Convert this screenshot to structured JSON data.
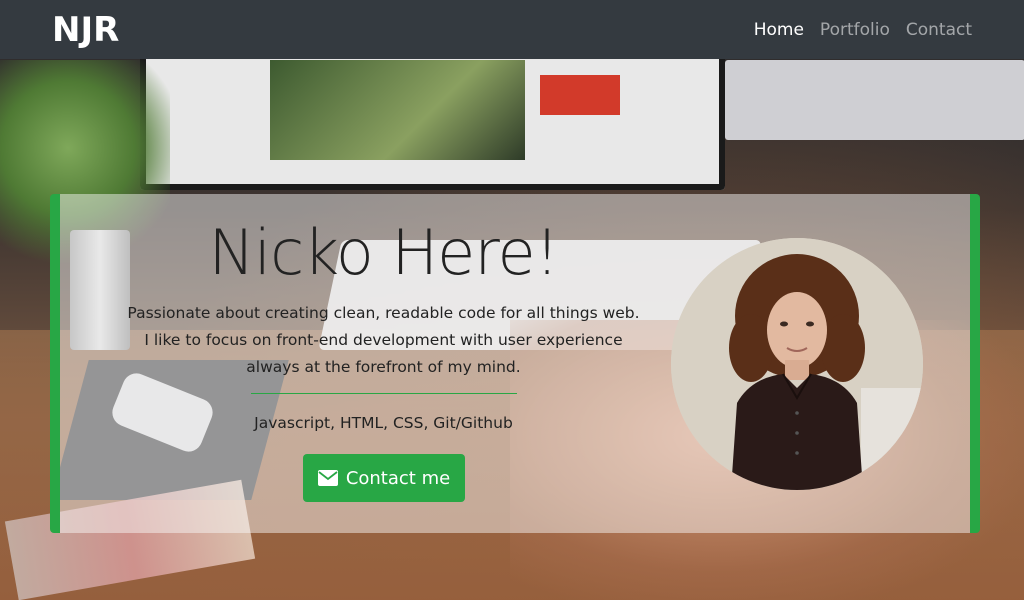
{
  "navbar": {
    "brand": "NJR",
    "links": [
      {
        "label": "Home",
        "active": true
      },
      {
        "label": "Portfolio",
        "active": false
      },
      {
        "label": "Contact",
        "active": false
      }
    ]
  },
  "hero": {
    "title": "Nicko Here!",
    "description": [
      "Passionate about creating clean, readable code for all things web.",
      "I like to focus on front-end development with user experience",
      "always at the forefront of my mind."
    ],
    "skills": "Javascript, HTML, CSS, Git/Github",
    "contact_button": {
      "label": "Contact me",
      "icon": "envelope-icon"
    }
  },
  "colors": {
    "navbar_bg": "#343a40",
    "accent_green": "#28a745",
    "nav_active": "#ffffff",
    "nav_inactive": "rgba(255,255,255,0.55)"
  }
}
